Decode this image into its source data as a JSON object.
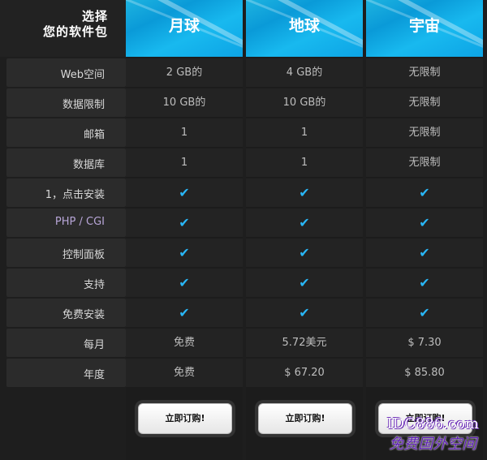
{
  "header": {
    "corner_line1": "选择",
    "corner_line2": "您的软件包"
  },
  "features": [
    "Web空间",
    "数据限制",
    "邮箱",
    "数据库",
    "1，点击安装",
    "PHP / CGI",
    "控制面板",
    "支持",
    "免费安装",
    "每月",
    "年度"
  ],
  "plans": [
    {
      "name": "月球",
      "values": [
        "2 GB的",
        "10 GB的",
        "1",
        "1",
        "✔",
        "✔",
        "✔",
        "✔",
        "✔",
        "免费",
        "免费"
      ],
      "button": "立即订购!"
    },
    {
      "name": "地球",
      "values": [
        "4 GB的",
        "10 GB的",
        "1",
        "1",
        "✔",
        "✔",
        "✔",
        "✔",
        "✔",
        "5.72美元",
        "$ 67.20"
      ],
      "button": "立即订购!"
    },
    {
      "name": "宇宙",
      "values": [
        "无限制",
        "无限制",
        "无限制",
        "无限制",
        "✔",
        "✔",
        "✔",
        "✔",
        "✔",
        "$ 7.30",
        "$ 85.80"
      ],
      "button": "立即订购!"
    }
  ],
  "watermark": {
    "line1": "IDC886.com",
    "line2": "免费国外空间"
  },
  "colors": {
    "accent": "#1aa7e6",
    "check": "#29b6f6"
  }
}
